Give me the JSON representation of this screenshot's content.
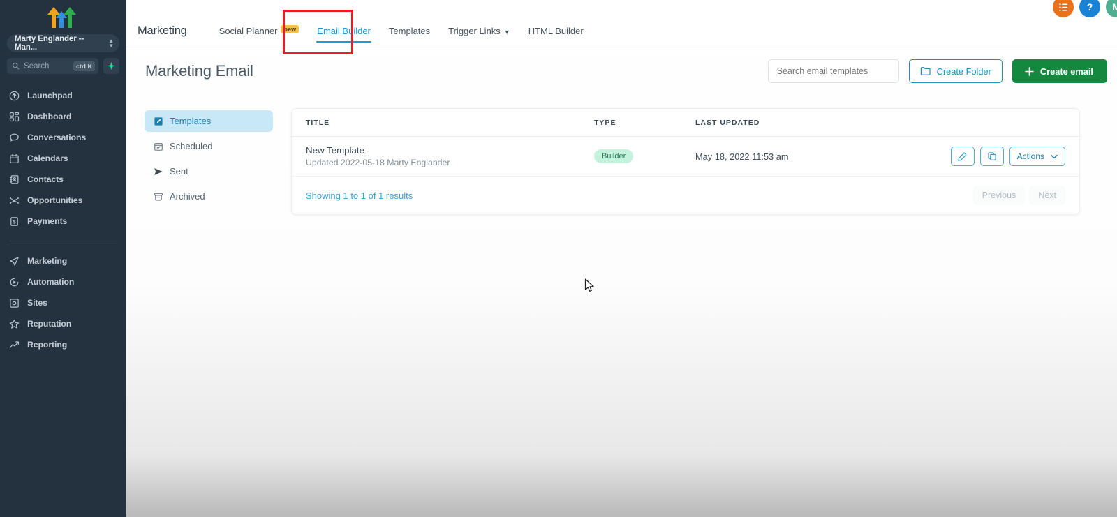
{
  "sidebar": {
    "logo": "three-arrows-logo",
    "account": {
      "name": "Marty Englander -- Man...",
      "icon": "updown-chevron-icon"
    },
    "search": {
      "placeholder": "Search",
      "shortcut": "ctrl K",
      "icon": "search-icon",
      "ai_icon": "sparkle-icon"
    },
    "nav_primary": [
      {
        "label": "Launchpad",
        "icon": "launchpad-icon"
      },
      {
        "label": "Dashboard",
        "icon": "dashboard-icon"
      },
      {
        "label": "Conversations",
        "icon": "chat-bubble-icon"
      },
      {
        "label": "Calendars",
        "icon": "calendar-icon"
      },
      {
        "label": "Contacts",
        "icon": "contacts-icon"
      },
      {
        "label": "Opportunities",
        "icon": "opportunities-icon"
      },
      {
        "label": "Payments",
        "icon": "payments-icon"
      }
    ],
    "nav_secondary": [
      {
        "label": "Marketing",
        "icon": "paper-plane-icon"
      },
      {
        "label": "Automation",
        "icon": "automation-icon"
      },
      {
        "label": "Sites",
        "icon": "sites-icon"
      },
      {
        "label": "Reputation",
        "icon": "star-icon"
      },
      {
        "label": "Reporting",
        "icon": "trending-up-icon"
      }
    ]
  },
  "topbar": {
    "brand": "Marketing",
    "tabs": [
      {
        "label": "Social Planner",
        "badge": "new",
        "active": false,
        "caret": false
      },
      {
        "label": "Email Builder",
        "badge": "",
        "active": true,
        "caret": false
      },
      {
        "label": "Templates",
        "badge": "",
        "active": false,
        "caret": false
      },
      {
        "label": "Trigger Links",
        "badge": "",
        "active": false,
        "caret": true
      },
      {
        "label": "HTML Builder",
        "badge": "",
        "active": false,
        "caret": false
      }
    ],
    "caret_glyph": "⌄",
    "icons": [
      {
        "name": "notes-list-icon",
        "glyph": "☰",
        "color": "#e8711a"
      },
      {
        "name": "help-icon",
        "glyph": "?",
        "color": "#1a82d4"
      },
      {
        "name": "user-avatar",
        "glyph": "M",
        "color": "#4fae8f"
      }
    ]
  },
  "page": {
    "title": "Marketing Email",
    "search_placeholder": "Search email templates",
    "create_folder_label": "Create Folder",
    "create_folder_icon": "folder-icon",
    "create_email_label": "Create email",
    "create_email_icon": "plus-icon",
    "accent_blue": "#1b9cd8",
    "accent_green": "#14883e",
    "annotation_color": "#ec1c24"
  },
  "left_menu": [
    {
      "label": "Templates",
      "icon": "template-icon",
      "active": true
    },
    {
      "label": "Scheduled",
      "icon": "calendar-check-icon",
      "active": false
    },
    {
      "label": "Sent",
      "icon": "send-icon",
      "active": false
    },
    {
      "label": "Archived",
      "icon": "archive-icon",
      "active": false
    }
  ],
  "table": {
    "headers": {
      "title": "TITLE",
      "type": "TYPE",
      "updated": "LAST UPDATED",
      "actions": ""
    },
    "rows": [
      {
        "title": "New Template",
        "subtitle": "Updated 2022-05-18 Marty Englander",
        "type": "Builder",
        "last_updated": "May 18, 2022 11:53 am",
        "edit_icon": "pencil-icon",
        "duplicate_icon": "copy-icon",
        "actions_label": "Actions",
        "actions_caret": "⌄"
      }
    ],
    "footer": {
      "showing": "Showing 1 to 1 of 1 results",
      "previous": "Previous",
      "next": "Next"
    }
  }
}
